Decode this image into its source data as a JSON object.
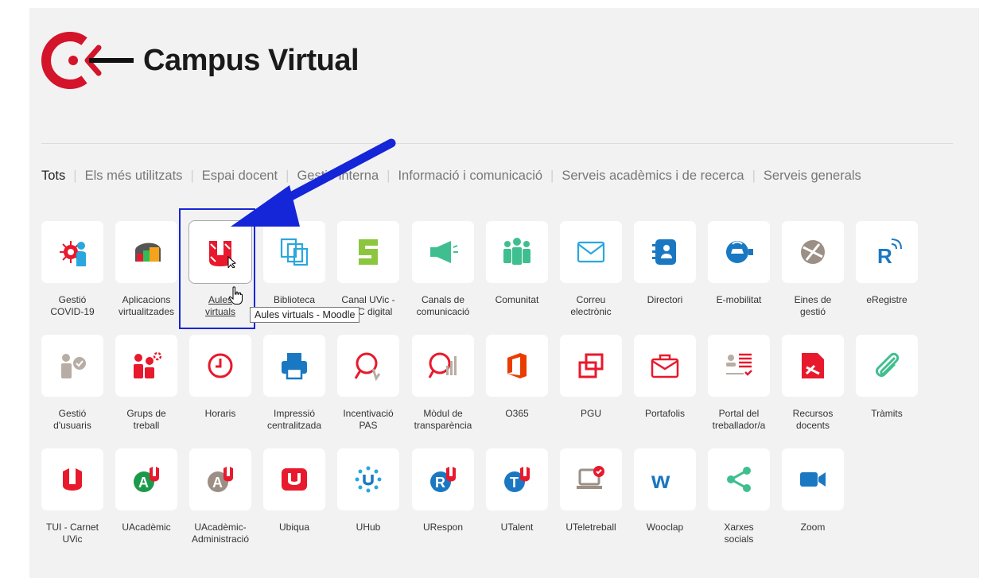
{
  "header": {
    "title": "Campus Virtual"
  },
  "tabs": [
    {
      "label": "Tots",
      "active": true
    },
    {
      "label": "Els més utilitzats"
    },
    {
      "label": "Espai docent"
    },
    {
      "label": "Gestió interna"
    },
    {
      "label": "Informació i comunicació"
    },
    {
      "label": "Serveis acadèmics i de recerca"
    },
    {
      "label": "Serveis generals"
    }
  ],
  "apps": [
    {
      "label": "Gestió\nCOVID-19",
      "icon": "covid-icon"
    },
    {
      "label": "Aplicacions\nvirtualitzades",
      "icon": "apps-icon"
    },
    {
      "label": "Aules\nvirtuals",
      "icon": "moodle-u-icon"
    },
    {
      "label": "Biblioteca",
      "icon": "library-icon"
    },
    {
      "label": "Canal UVic -\nUCC digital",
      "icon": "canal-icon"
    },
    {
      "label": "Canals de\ncomunicació",
      "icon": "megaphone-icon"
    },
    {
      "label": "Comunitat",
      "icon": "community-icon"
    },
    {
      "label": "Correu\nelectrònic",
      "icon": "mail-icon"
    },
    {
      "label": "Directori",
      "icon": "directory-icon"
    },
    {
      "label": "E-mobilitat",
      "icon": "emobility-icon"
    },
    {
      "label": "Eines de\ngestió",
      "icon": "tools-icon"
    },
    {
      "label": "eRegistre",
      "icon": "eregistre-icon"
    },
    {
      "label": "Gestió\nd'usuaris",
      "icon": "user-check-icon"
    },
    {
      "label": "Grups de\ntreball",
      "icon": "work-groups-icon"
    },
    {
      "label": "Horaris",
      "icon": "clock-icon"
    },
    {
      "label": "Impressió\ncentralitzada",
      "icon": "printer-icon"
    },
    {
      "label": "Incentivació\nPAS",
      "icon": "award-icon"
    },
    {
      "label": "Mòdul de\ntransparència",
      "icon": "transparency-icon"
    },
    {
      "label": "O365",
      "icon": "office-icon"
    },
    {
      "label": "PGU",
      "icon": "pgu-icon"
    },
    {
      "label": "Portafolis",
      "icon": "briefcase-icon"
    },
    {
      "label": "Portal del\ntreballador/a",
      "icon": "worker-portal-icon"
    },
    {
      "label": "Recursos\ndocents",
      "icon": "resources-icon"
    },
    {
      "label": "Tràmits",
      "icon": "paperclip-icon"
    },
    {
      "label": "TUI - Carnet\nUVic",
      "icon": "tui-icon"
    },
    {
      "label": "UAcadèmic",
      "icon": "uacademic-icon"
    },
    {
      "label": "UAcadèmic-\nAdministració",
      "icon": "uacademic-admin-icon"
    },
    {
      "label": "Ubiqua",
      "icon": "ubiqua-icon"
    },
    {
      "label": "UHub",
      "icon": "uhub-icon"
    },
    {
      "label": "URespon",
      "icon": "urespon-icon"
    },
    {
      "label": "UTalent",
      "icon": "utalent-icon"
    },
    {
      "label": "UTeletreball",
      "icon": "uteletreball-icon"
    },
    {
      "label": "Wooclap",
      "icon": "wooclap-icon"
    },
    {
      "label": "Xarxes\nsocials",
      "icon": "share-icon"
    },
    {
      "label": "Zoom",
      "icon": "zoom-icon"
    }
  ],
  "tooltip": "Aules virtuals - Moodle",
  "colors": {
    "brand": "#d4142a",
    "annotation": "#1525d8"
  }
}
